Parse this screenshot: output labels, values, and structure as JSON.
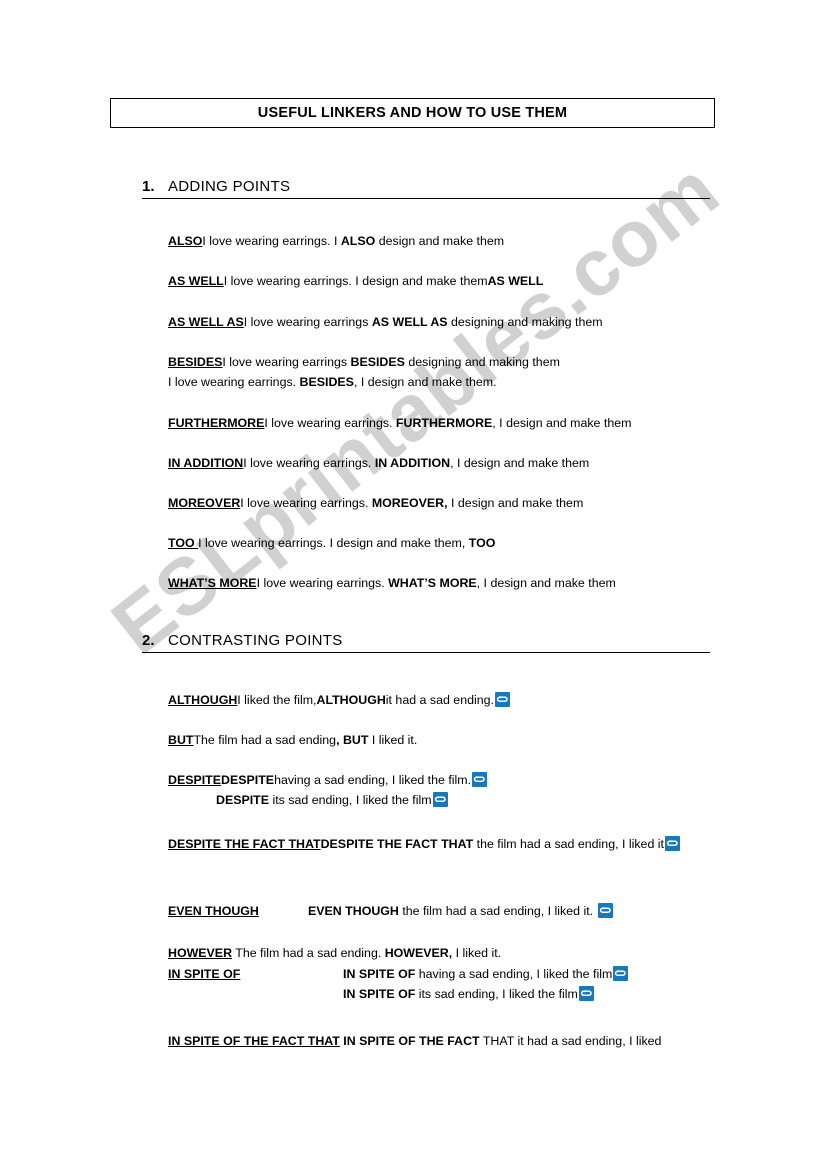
{
  "document": {
    "title": "USEFUL LINKERS AND HOW TO USE THEM",
    "watermark": "ESLprintables.com",
    "icon_name": "repeat-loop-icon",
    "icon_color": "#1878be"
  },
  "sections": [
    {
      "number": "1.",
      "heading": "ADDING POINTS",
      "entries": [
        {
          "label": "ALSO",
          "parts": [
            {
              "text": "I love wearing earrings. I ",
              "bold": false
            },
            {
              "text": "ALSO",
              "bold": true
            },
            {
              "text": " design and make them",
              "bold": false
            }
          ]
        },
        {
          "label": "AS WELL",
          "parts": [
            {
              "text": "I love wearing earrings. I design and make them",
              "bold": false
            },
            {
              "text": "AS WELL",
              "bold": true
            }
          ]
        },
        {
          "label": "AS WELL AS",
          "parts": [
            {
              "text": "I love wearing earrings ",
              "bold": false
            },
            {
              "text": "AS WELL AS",
              "bold": true
            },
            {
              "text": " designing and making them",
              "bold": false
            }
          ]
        },
        {
          "label": "BESIDES",
          "parts": [
            {
              "text": "I love wearing earrings ",
              "bold": false
            },
            {
              "text": "BESIDES",
              "bold": true
            },
            {
              "text": " designing and making them",
              "bold": false
            }
          ],
          "second_line": [
            {
              "text": "I love wearing earrings. ",
              "bold": false
            },
            {
              "text": "BESIDES",
              "bold": true
            },
            {
              "text": ", I design and make them.",
              "bold": false
            }
          ]
        },
        {
          "label": "FURTHERMORE",
          "parts": [
            {
              "text": "I love wearing earrings. ",
              "bold": false
            },
            {
              "text": "FURTHERMORE",
              "bold": true
            },
            {
              "text": ", I design and make them",
              "bold": false
            }
          ]
        },
        {
          "label": "IN ADDITION",
          "parts": [
            {
              "text": "I love wearing earrings. ",
              "bold": false
            },
            {
              "text": "IN ADDITION",
              "bold": true
            },
            {
              "text": ", I design and make them",
              "bold": false
            }
          ]
        },
        {
          "label": "MOREOVER",
          "parts": [
            {
              "text": "I love wearing earrings. ",
              "bold": false
            },
            {
              "text": "MOREOVER,",
              "bold": true
            },
            {
              "text": " I design and make them",
              "bold": false
            }
          ]
        },
        {
          "label": "TOO ",
          "parts": [
            {
              "text": "I love wearing earrings. I design and make them, ",
              "bold": false
            },
            {
              "text": "TOO",
              "bold": true
            }
          ]
        },
        {
          "label": "WHAT’S MORE",
          "parts": [
            {
              "text": "I love wearing earrings. ",
              "bold": false
            },
            {
              "text": "WHAT’S MORE",
              "bold": true
            },
            {
              "text": ", I design and make them",
              "bold": false
            }
          ]
        }
      ]
    },
    {
      "number": "2.",
      "heading": "CONTRASTING POINTS",
      "entries": [
        {
          "label": "ALTHOUGH",
          "parts": [
            {
              "text": "I liked the film,",
              "bold": false
            },
            {
              "text": "ALTHOUGH",
              "bold": true
            },
            {
              "text": "it had a sad ending.",
              "bold": false
            },
            {
              "icon": "repeat-loop-icon"
            }
          ]
        },
        {
          "label": "BUT",
          "parts": [
            {
              "text": "The film had a sad ending",
              "bold": false
            },
            {
              "text": ", BUT",
              "bold": true
            },
            {
              "text": " I liked it.",
              "bold": false
            }
          ]
        },
        {
          "label": "DESPITE",
          "parts": [
            {
              "text": "DESPITE",
              "bold": true
            },
            {
              "text": "having a sad ending, I liked the film.",
              "bold": false
            },
            {
              "icon": "repeat-loop-icon"
            }
          ],
          "second_line": [
            {
              "text": "DESPITE",
              "bold": true
            },
            {
              "text": " its sad ending, I liked the film",
              "bold": false
            },
            {
              "icon": "repeat-loop-icon"
            }
          ],
          "second_line_indent": true
        },
        {
          "label": "DESPITE THE FACT THAT",
          "parts": [
            {
              "text": "DESPITE THE FACT THAT",
              "bold": true
            },
            {
              "text": " the film had a sad ending, I liked it",
              "bold": false
            },
            {
              "icon": "repeat-loop-icon"
            }
          ]
        },
        {
          "label": "EVEN THOUGH",
          "tab_gap": 140,
          "parts": [
            {
              "text": "EVEN THOUGH",
              "bold": true
            },
            {
              "text": " the film had a sad ending, I liked it. ",
              "bold": false
            },
            {
              "icon": "repeat-loop-icon"
            }
          ]
        },
        {
          "label": "HOWEVER",
          "parts": [
            {
              "text": "  The film had a sad ending. ",
              "bold": false
            },
            {
              "text": "HOWEVER,",
              "bold": true
            },
            {
              "text": " I liked it.",
              "bold": false
            }
          ]
        },
        {
          "label": "IN SPITE OF",
          "tab_gap": 175,
          "parts": [
            {
              "text": "IN SPITE OF",
              "bold": true
            },
            {
              "text": " having a sad ending, I liked the film",
              "bold": false
            },
            {
              "icon": "repeat-loop-icon"
            }
          ],
          "second_line": [
            {
              "text": "IN SPITE OF",
              "bold": true
            },
            {
              "text": " its sad ending, I liked the film",
              "bold": false
            },
            {
              "icon": "repeat-loop-icon"
            }
          ]
        },
        {
          "label": "IN SPITE OF THE FACT THAT",
          "parts": [
            {
              "text": "  IN SPITE OF THE FACT",
              "bold": true
            },
            {
              "text": " THAT it had a sad ending, I liked",
              "bold": false
            }
          ]
        }
      ]
    }
  ]
}
